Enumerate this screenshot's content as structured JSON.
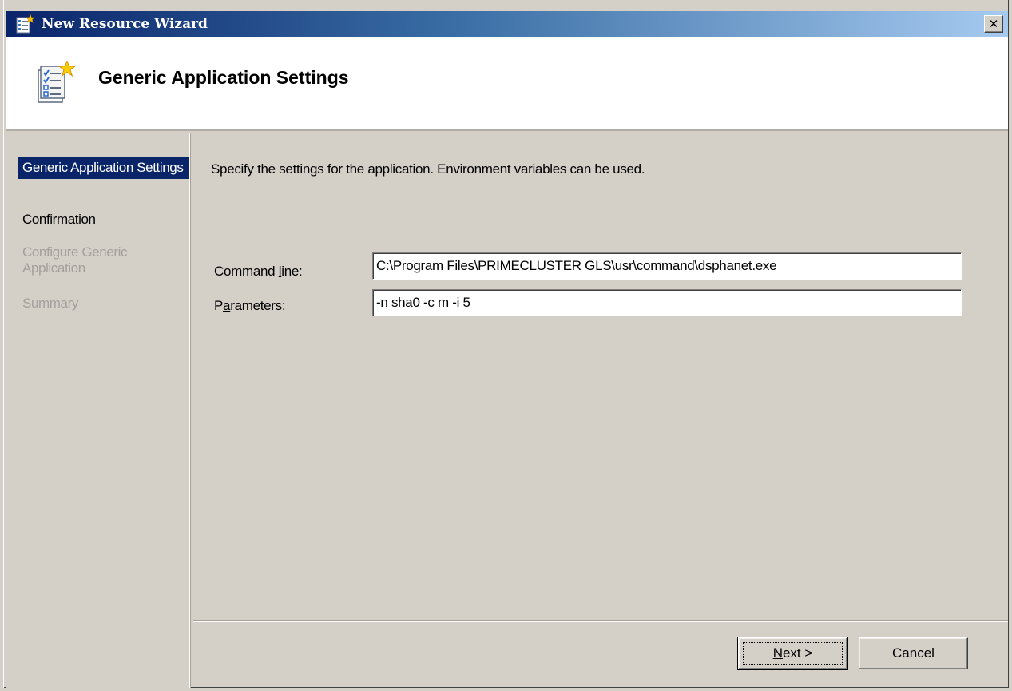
{
  "window": {
    "title": "New Resource Wizard",
    "close_label": "✕"
  },
  "header": {
    "title": "Generic Application Settings"
  },
  "sidebar": {
    "steps": [
      {
        "label": "Generic Application Settings",
        "state": "active"
      },
      {
        "label": "Confirmation",
        "state": "enabled"
      },
      {
        "label": "Configure Generic Application",
        "state": "disabled"
      },
      {
        "label": "Summary",
        "state": "disabled"
      }
    ]
  },
  "main": {
    "instruction": "Specify the settings for the application.  Environment variables can be used.",
    "command_line": {
      "label_pre": "Command ",
      "label_accel": "l",
      "label_post": "ine:",
      "value": "C:\\Program Files\\PRIMECLUSTER GLS\\usr\\command\\dsphanet.exe"
    },
    "parameters": {
      "label_pre": "P",
      "label_accel": "a",
      "label_post": "rameters:",
      "value": "-n sha0 -c m -i 5"
    }
  },
  "buttons": {
    "next_accel": "N",
    "next_rest": "ext >",
    "cancel": "Cancel"
  },
  "colors": {
    "titlebar_start": "#0a246a",
    "titlebar_end": "#a6caf0",
    "active_step_bg": "#0a246a",
    "dialog_bg": "#d4d0c8"
  },
  "icons": {
    "title": "wizard-document-icon",
    "header": "wizard-checklist-icon"
  }
}
